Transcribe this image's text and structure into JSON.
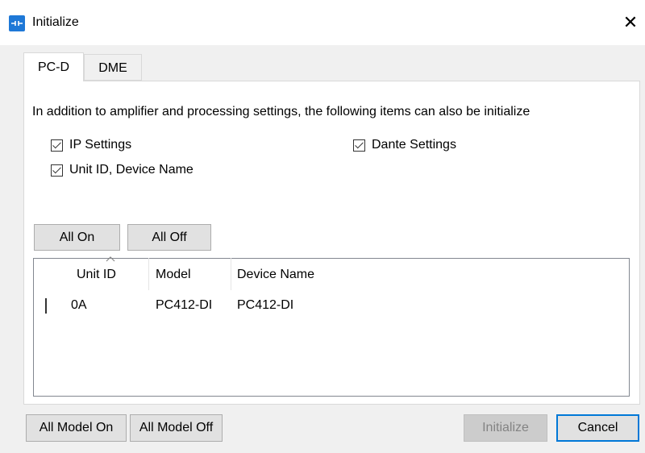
{
  "window": {
    "title": "Initialize",
    "accent": "#1e78d7"
  },
  "tabs": [
    {
      "label": "PC-D",
      "selected": true
    },
    {
      "label": "DME",
      "selected": false
    }
  ],
  "panel": {
    "description": "In addition to amplifier and processing settings, the following items can also be initialize",
    "options": {
      "ip_settings": {
        "label": "IP Settings",
        "checked": true
      },
      "unit_id_device_name": {
        "label": "Unit ID, Device Name",
        "checked": true
      },
      "dante_settings": {
        "label": "Dante Settings",
        "checked": true
      }
    },
    "buttons": {
      "all_on": "All On",
      "all_off": "All Off"
    }
  },
  "device_list": {
    "columns": [
      "Unit ID",
      "Model",
      "Device Name"
    ],
    "sort_column": "Unit ID",
    "rows": [
      {
        "checked": false,
        "unit_id": "0A",
        "model": "PC412-DI",
        "device_name": "PC412-DI"
      }
    ]
  },
  "footer": {
    "all_model_on": "All Model On",
    "all_model_off": "All Model Off",
    "initialize": "Initialize",
    "initialize_enabled": false,
    "cancel": "Cancel"
  }
}
